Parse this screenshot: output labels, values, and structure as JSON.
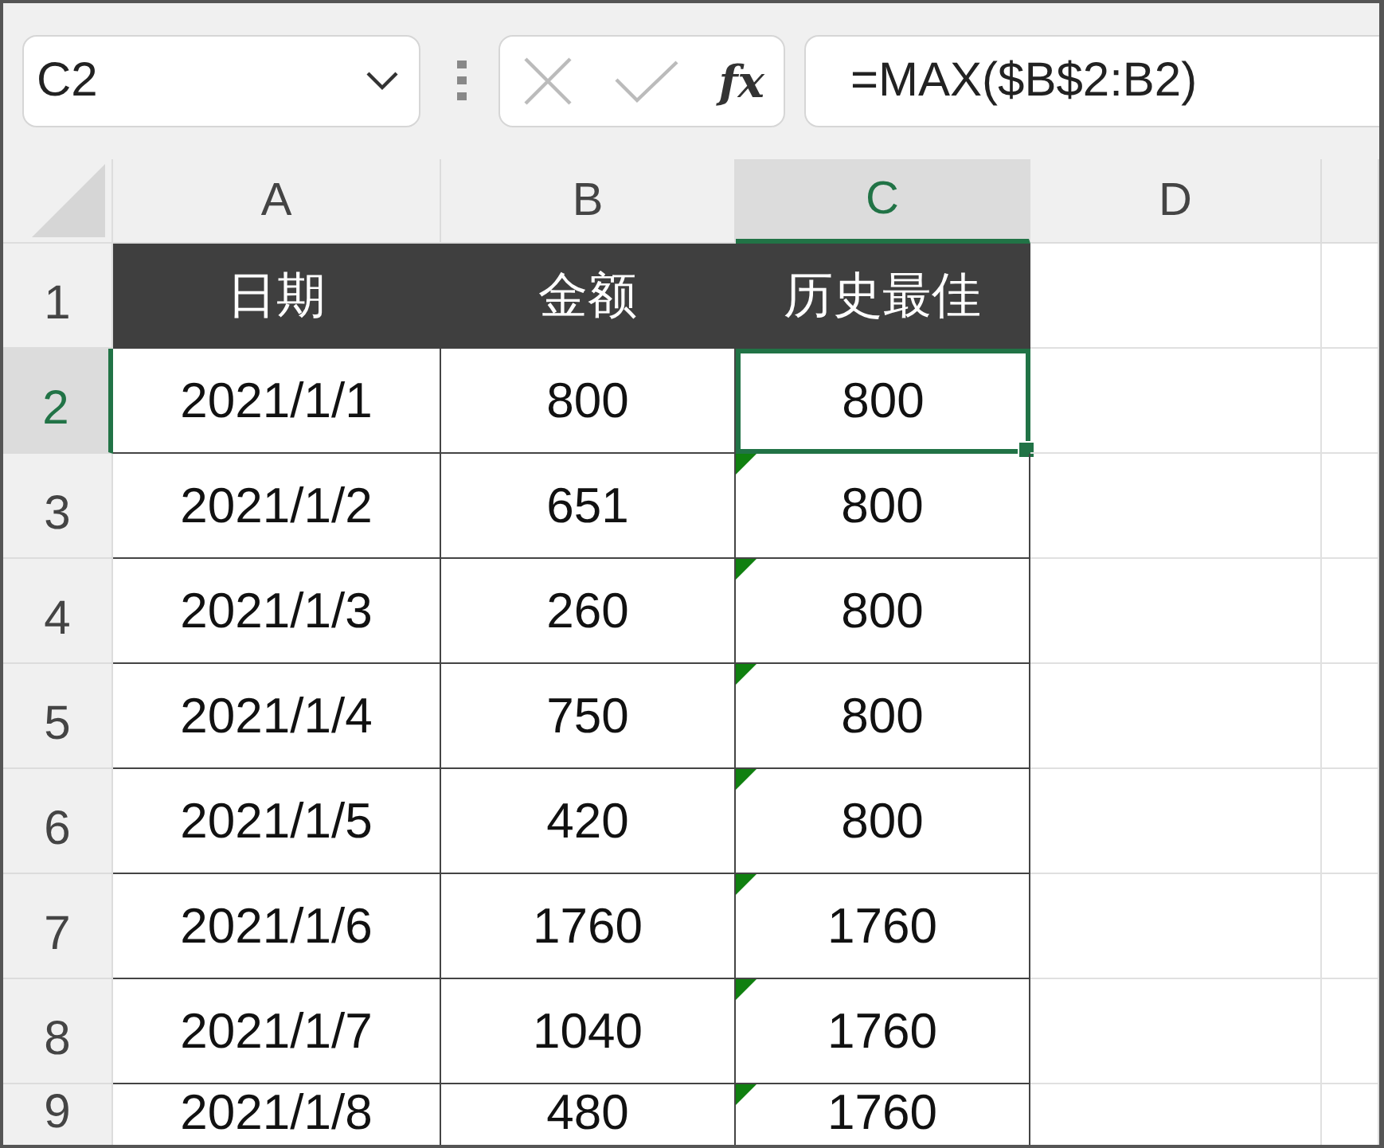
{
  "name_box": {
    "value": "C2"
  },
  "formula_bar": {
    "function_label": "fx",
    "value": "=MAX($B$2:B2)"
  },
  "columns": [
    {
      "label": "A",
      "selected": false
    },
    {
      "label": "B",
      "selected": false
    },
    {
      "label": "C",
      "selected": true
    },
    {
      "label": "D",
      "selected": false
    }
  ],
  "rows": [
    {
      "number": "1",
      "selected": false,
      "kind": "header",
      "cells": [
        {
          "text": "日期",
          "selected": false,
          "error_flag": false
        },
        {
          "text": "金额",
          "selected": false,
          "error_flag": false
        },
        {
          "text": "历史最佳",
          "selected": false,
          "error_flag": false
        }
      ]
    },
    {
      "number": "2",
      "selected": true,
      "kind": "data",
      "cells": [
        {
          "text": "2021/1/1",
          "selected": false,
          "error_flag": false
        },
        {
          "text": "800",
          "selected": false,
          "error_flag": false
        },
        {
          "text": "800",
          "selected": true,
          "error_flag": false
        }
      ]
    },
    {
      "number": "3",
      "selected": false,
      "kind": "data",
      "cells": [
        {
          "text": "2021/1/2",
          "selected": false,
          "error_flag": false
        },
        {
          "text": "651",
          "selected": false,
          "error_flag": false
        },
        {
          "text": "800",
          "selected": false,
          "error_flag": true
        }
      ]
    },
    {
      "number": "4",
      "selected": false,
      "kind": "data",
      "cells": [
        {
          "text": "2021/1/3",
          "selected": false,
          "error_flag": false
        },
        {
          "text": "260",
          "selected": false,
          "error_flag": false
        },
        {
          "text": "800",
          "selected": false,
          "error_flag": true
        }
      ]
    },
    {
      "number": "5",
      "selected": false,
      "kind": "data",
      "cells": [
        {
          "text": "2021/1/4",
          "selected": false,
          "error_flag": false
        },
        {
          "text": "750",
          "selected": false,
          "error_flag": false
        },
        {
          "text": "800",
          "selected": false,
          "error_flag": true
        }
      ]
    },
    {
      "number": "6",
      "selected": false,
      "kind": "data",
      "cells": [
        {
          "text": "2021/1/5",
          "selected": false,
          "error_flag": false
        },
        {
          "text": "420",
          "selected": false,
          "error_flag": false
        },
        {
          "text": "800",
          "selected": false,
          "error_flag": true
        }
      ]
    },
    {
      "number": "7",
      "selected": false,
      "kind": "data",
      "cells": [
        {
          "text": "2021/1/6",
          "selected": false,
          "error_flag": false
        },
        {
          "text": "1760",
          "selected": false,
          "error_flag": false
        },
        {
          "text": "1760",
          "selected": false,
          "error_flag": true
        }
      ]
    },
    {
      "number": "8",
      "selected": false,
      "kind": "data",
      "cells": [
        {
          "text": "2021/1/7",
          "selected": false,
          "error_flag": false
        },
        {
          "text": "1040",
          "selected": false,
          "error_flag": false
        },
        {
          "text": "1760",
          "selected": false,
          "error_flag": true
        }
      ]
    },
    {
      "number": "9",
      "selected": false,
      "kind": "data",
      "cells": [
        {
          "text": "2021/1/8",
          "selected": false,
          "error_flag": false
        },
        {
          "text": "480",
          "selected": false,
          "error_flag": false
        },
        {
          "text": "1760",
          "selected": false,
          "error_flag": true
        }
      ]
    }
  ]
}
